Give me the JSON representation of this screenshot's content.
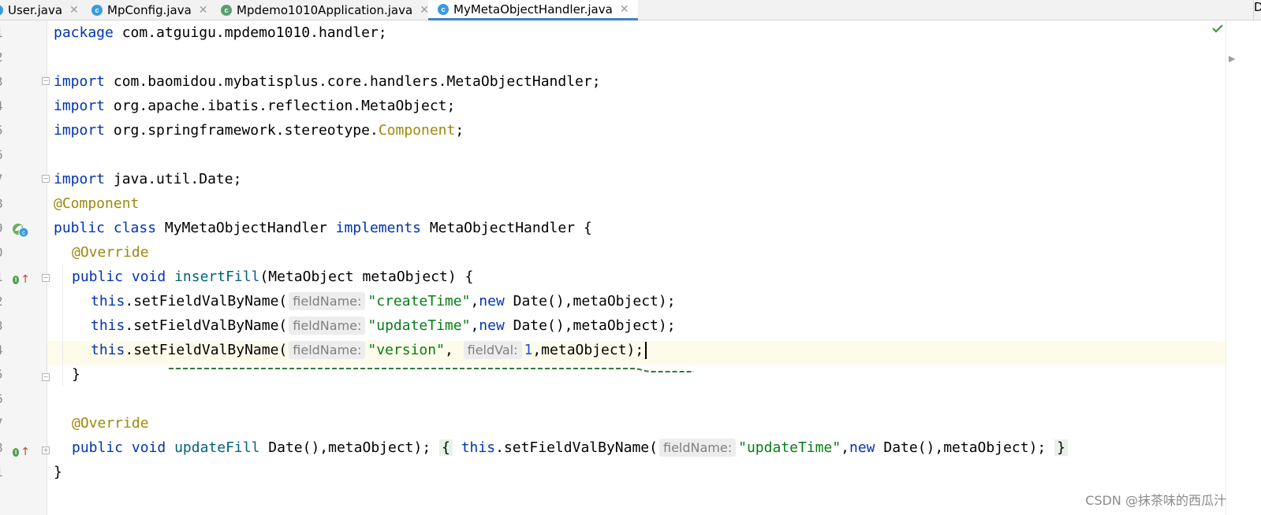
{
  "tabs": [
    {
      "name": "User.java",
      "icon": "C",
      "active": false
    },
    {
      "name": "MpConfig.java",
      "icon": "C",
      "active": false
    },
    {
      "name": "Mpdemo1010Application.java",
      "icon": "C",
      "active": false
    },
    {
      "name": "MyMetaObjectHandler.java",
      "icon": "C",
      "active": true
    }
  ],
  "tab_right_fragment": "D",
  "line_numbers": [
    "1",
    "2",
    "3",
    "4",
    "5",
    "6",
    "7",
    "8",
    "9",
    "0",
    "1",
    "2",
    "3",
    "4",
    "5",
    "6",
    "7",
    "8",
    "1"
  ],
  "code": {
    "l1_pkg": "package",
    "l1_name": " com.atguigu.mpdemo1010.handler;",
    "l3_kw": "import",
    "l3_rest": " com.baomidou.mybatisplus.core.handlers.MetaObjectHandler;",
    "l4_kw": "import",
    "l4_rest": " org.apache.ibatis.reflection.MetaObject;",
    "l5_kw": "import",
    "l5_rest": " org.springframework.stereotype.",
    "l5_anno": "Component",
    "l5_end": ";",
    "l7_kw": "import",
    "l7_rest": " java.util.Date;",
    "l8_anno": "@Component",
    "l9_kw1": "public class",
    "l9_cls": " MyMetaObjectHandler ",
    "l9_kw2": "implements",
    "l9_rest": " MetaObjectHandler {",
    "l10_anno": "@Override",
    "l11_kw": "public void",
    "l11_fn": "insertFill",
    "l11_rest": "(MetaObject metaObject) {",
    "l12_this": "this",
    "l12_call": ".setFieldValByName(",
    "l12_hint": "fieldName:",
    "l12_str": "\"createTime\"",
    "l12_comma": ",",
    "l12_new": "new",
    "l12_rest": " Date(),metaObject);",
    "l13_this": "this",
    "l13_call": ".setFieldValByName(",
    "l13_hint": "fieldName:",
    "l13_str": "\"updateTime\"",
    "l13_comma": ",",
    "l13_new": "new",
    "l13_rest": " Date(),metaObject);",
    "l14_this": "this",
    "l14_call": ".setFieldValByName(",
    "l14_hint1": "fieldName:",
    "l14_str": "\"version\"",
    "l14_comma": ",",
    "l14_hint2": "fieldVal:",
    "l14_num": "1",
    "l14_rest": ",metaObject);",
    "l15_close": "}",
    "l17_anno": "@Override",
    "l18_kw": "public void",
    "l18_fn": "updateFill",
    "l18_rest": " Date(),metaObject);",
    "l18_open": "{",
    "l18_this": "this",
    "l18_call": ".setFieldValByName(",
    "l18_hint": "fieldName:",
    "l18_str": "\"updateTime\"",
    "l18_comma": ",",
    "l18_new": "new",
    "l18_close": "}",
    "l19_close": "}"
  },
  "watermark": "CSDN @抹茶味的西瓜汁",
  "colors": {
    "keyword": "#0033b3",
    "annotation": "#9e880d",
    "string": "#067d17",
    "number": "#1750eb",
    "method": "#00627a",
    "active_tab_underline": "#4083c9",
    "annotation_squiggle": "#2e7d32"
  },
  "icons": {
    "tab_icon": "class-icon",
    "gutter_line9": "spring-bean-icon",
    "gutter_line11": "implements-method-icon",
    "gutter_line18": "implements-method-icon",
    "inspection": "checkmark-icon"
  }
}
